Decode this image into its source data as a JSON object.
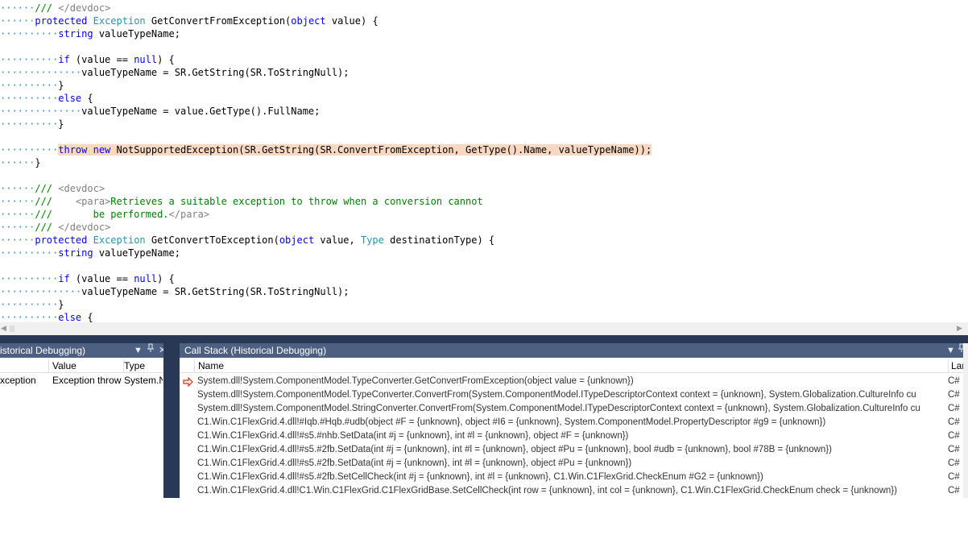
{
  "editor": {
    "lines": [
      {
        "dots": "······",
        "tokens": [
          {
            "c": "cm",
            "t": "/// "
          },
          {
            "c": "cg",
            "t": "</devdoc>"
          }
        ]
      },
      {
        "dots": "······",
        "tokens": [
          {
            "c": "kw",
            "t": "protected"
          },
          {
            "c": "tx",
            "t": " "
          },
          {
            "c": "ty",
            "t": "Exception"
          },
          {
            "c": "tx",
            "t": " GetConvertFromException("
          },
          {
            "c": "kw",
            "t": "object"
          },
          {
            "c": "tx",
            "t": " value) {"
          }
        ]
      },
      {
        "dots": "··········",
        "tokens": [
          {
            "c": "kw",
            "t": "string"
          },
          {
            "c": "tx",
            "t": " valueTypeName;"
          }
        ]
      },
      {
        "dots": "",
        "tokens": []
      },
      {
        "dots": "··········",
        "tokens": [
          {
            "c": "kw",
            "t": "if"
          },
          {
            "c": "tx",
            "t": " (value == "
          },
          {
            "c": "kw",
            "t": "null"
          },
          {
            "c": "tx",
            "t": ") {"
          }
        ]
      },
      {
        "dots": "··············",
        "tokens": [
          {
            "c": "tx",
            "t": "valueTypeName = SR.GetString(SR.ToStringNull);"
          }
        ]
      },
      {
        "dots": "··········",
        "tokens": [
          {
            "c": "tx",
            "t": "}"
          }
        ]
      },
      {
        "dots": "··········",
        "tokens": [
          {
            "c": "kw",
            "t": "else"
          },
          {
            "c": "tx",
            "t": " {"
          }
        ]
      },
      {
        "dots": "··············",
        "tokens": [
          {
            "c": "tx",
            "t": "valueTypeName = value.GetType().FullName;"
          }
        ]
      },
      {
        "dots": "··········",
        "tokens": [
          {
            "c": "tx",
            "t": "}"
          }
        ]
      },
      {
        "dots": "",
        "tokens": []
      },
      {
        "dots": "··········",
        "highlight": true,
        "tokens": [
          {
            "c": "kw",
            "t": "throw"
          },
          {
            "c": "tx",
            "t": " "
          },
          {
            "c": "kw",
            "t": "new"
          },
          {
            "c": "tx",
            "t": " NotSupportedException(SR.GetString(SR.ConvertFromException, GetType().Name, valueTypeName));"
          }
        ]
      },
      {
        "dots": "······",
        "tokens": [
          {
            "c": "tx",
            "t": "}"
          }
        ]
      },
      {
        "dots": "",
        "tokens": []
      },
      {
        "dots": "······",
        "tokens": [
          {
            "c": "cm",
            "t": "/// "
          },
          {
            "c": "cg",
            "t": "<devdoc>"
          }
        ]
      },
      {
        "dots": "······",
        "tokens": [
          {
            "c": "cm",
            "t": "///    "
          },
          {
            "c": "cg",
            "t": "<para>"
          },
          {
            "c": "cm",
            "t": "Retrieves a suitable exception to throw when a conversion cannot"
          }
        ]
      },
      {
        "dots": "······",
        "tokens": [
          {
            "c": "cm",
            "t": "///       be performed."
          },
          {
            "c": "cg",
            "t": "</para>"
          }
        ]
      },
      {
        "dots": "······",
        "tokens": [
          {
            "c": "cm",
            "t": "/// "
          },
          {
            "c": "cg",
            "t": "</devdoc>"
          }
        ]
      },
      {
        "dots": "······",
        "tokens": [
          {
            "c": "kw",
            "t": "protected"
          },
          {
            "c": "tx",
            "t": " "
          },
          {
            "c": "ty",
            "t": "Exception"
          },
          {
            "c": "tx",
            "t": " GetConvertToException("
          },
          {
            "c": "kw",
            "t": "object"
          },
          {
            "c": "tx",
            "t": " value, "
          },
          {
            "c": "ty",
            "t": "Type"
          },
          {
            "c": "tx",
            "t": " destinationType) {"
          }
        ]
      },
      {
        "dots": "··········",
        "tokens": [
          {
            "c": "kw",
            "t": "string"
          },
          {
            "c": "tx",
            "t": " valueTypeName;"
          }
        ]
      },
      {
        "dots": "",
        "tokens": []
      },
      {
        "dots": "··········",
        "tokens": [
          {
            "c": "kw",
            "t": "if"
          },
          {
            "c": "tx",
            "t": " (value == "
          },
          {
            "c": "kw",
            "t": "null"
          },
          {
            "c": "tx",
            "t": ") {"
          }
        ]
      },
      {
        "dots": "··············",
        "tokens": [
          {
            "c": "tx",
            "t": "valueTypeName = SR.GetString(SR.ToStringNull);"
          }
        ]
      },
      {
        "dots": "··········",
        "tokens": [
          {
            "c": "tx",
            "t": "}"
          }
        ]
      },
      {
        "dots": "··········",
        "tokens": [
          {
            "c": "kw",
            "t": "else"
          },
          {
            "c": "tx",
            "t": " {"
          }
        ]
      }
    ]
  },
  "locals_panel": {
    "title": "istorical Debugging)",
    "columns": [
      "Value",
      "Type"
    ],
    "row": {
      "name": "xception",
      "value": "Exception throw",
      "type": "System.N"
    }
  },
  "callstack_panel": {
    "title": "Call Stack (Historical Debugging)",
    "columns": {
      "name": "Name",
      "lang": "Lan"
    },
    "rows": [
      {
        "name": "System.dll!System.ComponentModel.TypeConverter.GetConvertFromException(object value = {unknown})",
        "lang": "C#",
        "current": true
      },
      {
        "name": "System.dll!System.ComponentModel.TypeConverter.ConvertFrom(System.ComponentModel.ITypeDescriptorContext context = {unknown}, System.Globalization.CultureInfo cu",
        "lang": "C#"
      },
      {
        "name": "System.dll!System.ComponentModel.StringConverter.ConvertFrom(System.ComponentModel.ITypeDescriptorContext context = {unknown}, System.Globalization.CultureInfo cu",
        "lang": "C#"
      },
      {
        "name": "C1.Win.C1FlexGrid.4.dll!#Iqb.#Hqb.#udb(object #F = {unknown}, object #I6 = {unknown}, System.ComponentModel.PropertyDescriptor #g9 = {unknown})",
        "lang": "C#"
      },
      {
        "name": "C1.Win.C1FlexGrid.4.dll!#s5.#nhb.SetData(int #j = {unknown}, int #l = {unknown}, object #F = {unknown})",
        "lang": "C#"
      },
      {
        "name": "C1.Win.C1FlexGrid.4.dll!#s5.#2fb.SetData(int #j = {unknown}, int #l = {unknown}, object #Pu = {unknown}, bool #udb = {unknown}, bool #78B = {unknown})",
        "lang": "C#"
      },
      {
        "name": "C1.Win.C1FlexGrid.4.dll!#s5.#2fb.SetData(int #j = {unknown}, int #l = {unknown}, object #Pu = {unknown})",
        "lang": "C#"
      },
      {
        "name": "C1.Win.C1FlexGrid.4.dll!#s5.#2fb.SetCellCheck(int #j = {unknown}, int #l = {unknown}, C1.Win.C1FlexGrid.CheckEnum #G2 = {unknown})",
        "lang": "C#"
      },
      {
        "name": "C1.Win.C1FlexGrid.4.dll!C1.Win.C1FlexGrid.C1FlexGridBase.SetCellCheck(int row = {unknown}, int col = {unknown}, C1.Win.C1FlexGrid.CheckEnum check = {unknown})",
        "lang": "C#"
      }
    ]
  },
  "icons": {
    "dropdown": "chevron-down-icon",
    "pin": "pin-icon",
    "close": "close-icon",
    "current_frame": "arrow-right-icon"
  },
  "colors": {
    "panel_title_bg": "#4d6082",
    "divider": "#293955",
    "highlight": "#f8d8c0",
    "keyword": "#0000ff",
    "type": "#2b91af",
    "comment": "#008000"
  }
}
